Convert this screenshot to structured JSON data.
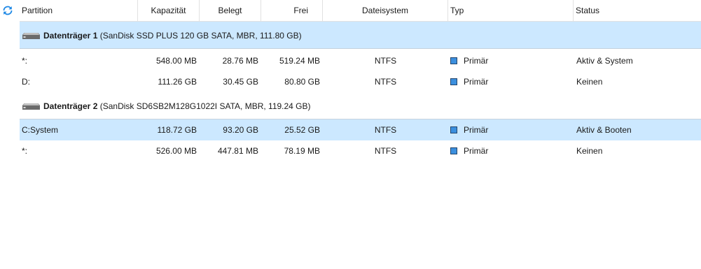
{
  "columns": {
    "partition": "Partition",
    "capacity": "Kapazität",
    "used": "Belegt",
    "free": "Frei",
    "filesystem": "Dateisystem",
    "type": "Typ",
    "status": "Status"
  },
  "disks": [
    {
      "name": "Datenträger 1",
      "details": "(SanDisk SSD PLUS 120 GB SATA, MBR, 111.80 GB)",
      "selected": true,
      "partitions": [
        {
          "partition": "*:",
          "capacity": "548.00 MB",
          "used": "28.76 MB",
          "free": "519.24 MB",
          "filesystem": "NTFS",
          "type": "Primär",
          "status": "Aktiv & System"
        },
        {
          "partition": "D:",
          "capacity": "111.26 GB",
          "used": "30.45 GB",
          "free": "80.80 GB",
          "filesystem": "NTFS",
          "type": "Primär",
          "status": "Keinen"
        }
      ]
    },
    {
      "name": "Datenträger 2",
      "details": "(SanDisk SD6SB2M128G1022I SATA, MBR, 119.24 GB)",
      "selected": false,
      "partitions": [
        {
          "partition": "C:System",
          "capacity": "118.72 GB",
          "used": "93.20 GB",
          "free": "25.52 GB",
          "filesystem": "NTFS",
          "type": "Primär",
          "status": "Aktiv & Booten",
          "selected": true
        },
        {
          "partition": "*:",
          "capacity": "526.00 MB",
          "used": "447.81 MB",
          "free": "78.19 MB",
          "filesystem": "NTFS",
          "type": "Primär",
          "status": "Keinen"
        }
      ]
    }
  ],
  "icons": {
    "refresh": "refresh-icon",
    "disk": "hard-disk-icon",
    "type": "primary-partition-square-icon"
  },
  "colors": {
    "selection": "#cce8ff",
    "primary_square": "#3b8fde",
    "refresh_icon": "#1e88e5"
  }
}
